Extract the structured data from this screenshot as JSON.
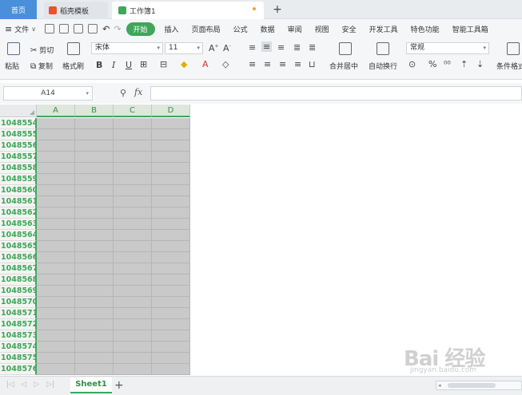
{
  "tabs": {
    "home": "首页",
    "template": "稻壳模板",
    "workbook": "工作簿1",
    "add": "+"
  },
  "menu": {
    "file": "文件",
    "file_caret": "∨",
    "items": [
      "开始",
      "插入",
      "页面布局",
      "公式",
      "数据",
      "审阅",
      "视图",
      "安全",
      "开发工具",
      "特色功能",
      "智能工具箱"
    ]
  },
  "ribbon": {
    "paste": "粘贴",
    "cut": "剪切",
    "copy": "复制",
    "format_painter": "格式刷",
    "font_name": "宋体",
    "font_size": "11",
    "bold": "B",
    "italic": "I",
    "underline": "U",
    "merge_center": "合并居中",
    "wrap_text": "自动换行",
    "number_format": "常规",
    "percent": "%",
    "conditional_format": "条件格式"
  },
  "formula_bar": {
    "cell_ref": "A14",
    "fx": "fx",
    "value": ""
  },
  "grid": {
    "columns": [
      "A",
      "B",
      "C",
      "D"
    ],
    "rows": [
      "1048554",
      "1048555",
      "1048556",
      "1048557",
      "1048558",
      "1048559",
      "1048560",
      "1048561",
      "1048562",
      "1048563",
      "1048564",
      "1048565",
      "1048566",
      "1048567",
      "1048568",
      "1048569",
      "1048570",
      "1048571",
      "1048572",
      "1048573",
      "1048574",
      "1048575",
      "1048576"
    ]
  },
  "sheets": {
    "active": "Sheet1",
    "add": "+"
  },
  "watermark": {
    "logo": "Bai 经验",
    "url": "jingyan.baidu.com"
  },
  "colors": {
    "accent_green": "#3fa65a",
    "home_tab_blue": "#4a8fd9",
    "cell_fill": "#c9c9c9"
  }
}
